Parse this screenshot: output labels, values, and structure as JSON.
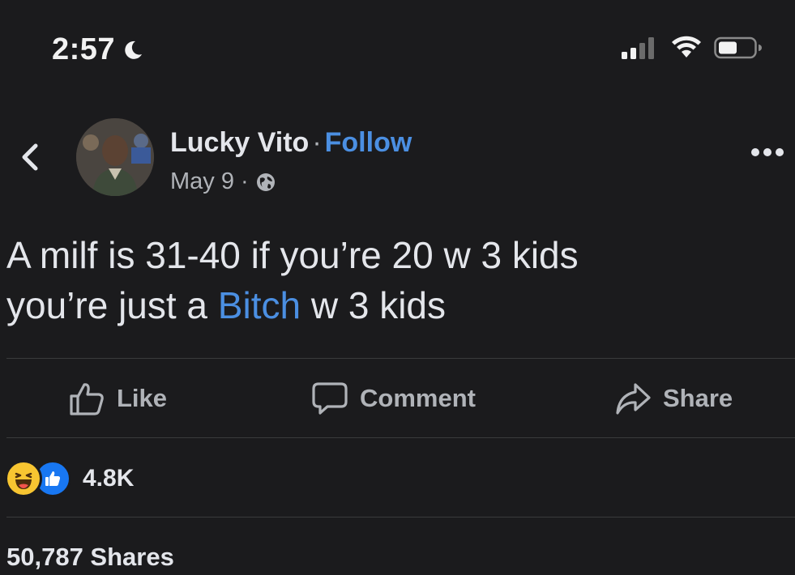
{
  "status_bar": {
    "time": "2:57",
    "icons": [
      "moon-icon",
      "cellular-signal-icon",
      "wifi-icon",
      "battery-icon"
    ]
  },
  "header": {
    "back_icon": "back-chevron-icon",
    "author_name": "Lucky Vito",
    "separator": "·",
    "follow_label": "Follow",
    "date": "May 9",
    "meta_separator": "·",
    "audience_icon": "globe-icon",
    "more_icon": "more-options-icon"
  },
  "post": {
    "line1": "A milf is 31-40 if you’re 20 w 3 kids",
    "line2_before": "you’re just a ",
    "line2_link": "Bitch",
    "line2_after": " w 3 kids"
  },
  "actions": {
    "like_label": "Like",
    "comment_label": "Comment",
    "share_label": "Share"
  },
  "reactions": {
    "types": [
      "haha",
      "like"
    ],
    "count": "4.8K"
  },
  "shares": {
    "label": "50,787 Shares"
  },
  "colors": {
    "background": "#1b1b1d",
    "link_blue": "#4b8fe2",
    "text_primary": "#e4e6eb",
    "text_secondary": "#b0b3b8",
    "like_blue": "#1877f2",
    "haha_yellow": "#f7c531"
  }
}
